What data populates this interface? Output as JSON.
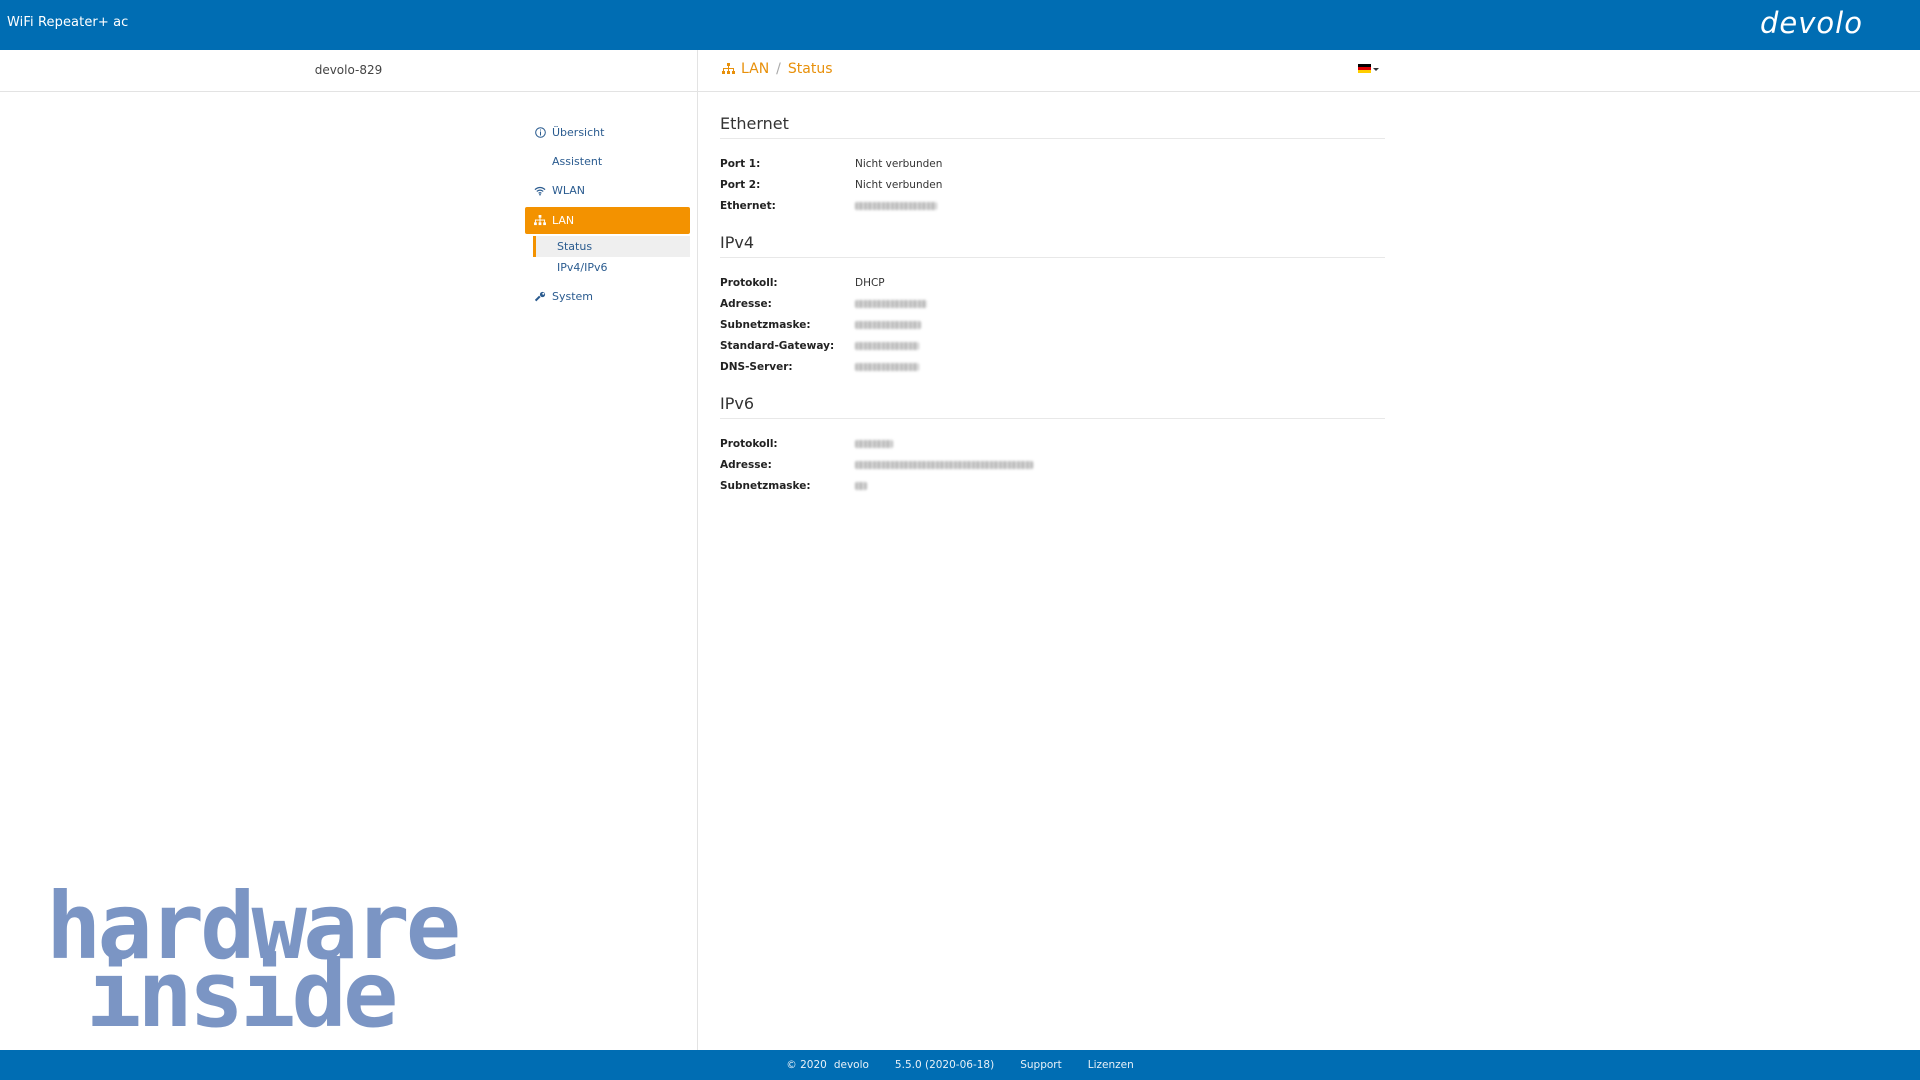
{
  "app": {
    "title": "WiFi Repeater+ ac",
    "logo_text": "devolo"
  },
  "header": {
    "device_name": "devolo-829",
    "breadcrumb": [
      "LAN",
      "Status"
    ],
    "language_flag": "de-flag-icon"
  },
  "sidebar": {
    "items": [
      {
        "label": "Übersicht",
        "icon": "info-icon"
      },
      {
        "label": "Assistent",
        "icon": ""
      },
      {
        "label": "WLAN",
        "icon": "wifi-icon"
      },
      {
        "label": "LAN",
        "icon": "network-icon"
      },
      {
        "label": "System",
        "icon": "wrench-icon"
      }
    ],
    "lan_sub": [
      {
        "label": "Status"
      },
      {
        "label": "IPv4/IPv6"
      }
    ]
  },
  "sections": {
    "ethernet": {
      "title": "Ethernet",
      "rows": [
        {
          "label": "Port 1:",
          "value": "Nicht verbunden"
        },
        {
          "label": "Port 2:",
          "value": "Nicht verbunden"
        },
        {
          "label": "Ethernet:",
          "value": ""
        }
      ]
    },
    "ipv4": {
      "title": "IPv4",
      "rows": [
        {
          "label": "Protokoll:",
          "value": "DHCP"
        },
        {
          "label": "Adresse:",
          "value": ""
        },
        {
          "label": "Subnetzmaske:",
          "value": ""
        },
        {
          "label": "Standard-Gateway:",
          "value": ""
        },
        {
          "label": "DNS-Server:",
          "value": ""
        }
      ]
    },
    "ipv6": {
      "title": "IPv6",
      "rows": [
        {
          "label": "Protokoll:",
          "value": ""
        },
        {
          "label": "Adresse:",
          "value": ""
        },
        {
          "label": "Subnetzmaske:",
          "value": ""
        }
      ]
    }
  },
  "watermark": {
    "line1": "hardware",
    "line2": "inside"
  },
  "footer": {
    "copyright": "© 2020",
    "brand": "devolo",
    "version": "5.5.0 (2020-06-18)",
    "support": "Support",
    "licenses": "Lizenzen"
  },
  "colors": {
    "primary_blue": "#006db3",
    "accent_orange": "#f39200",
    "watermark_orange": "#e8896a",
    "watermark_blue": "#7b95c4"
  }
}
